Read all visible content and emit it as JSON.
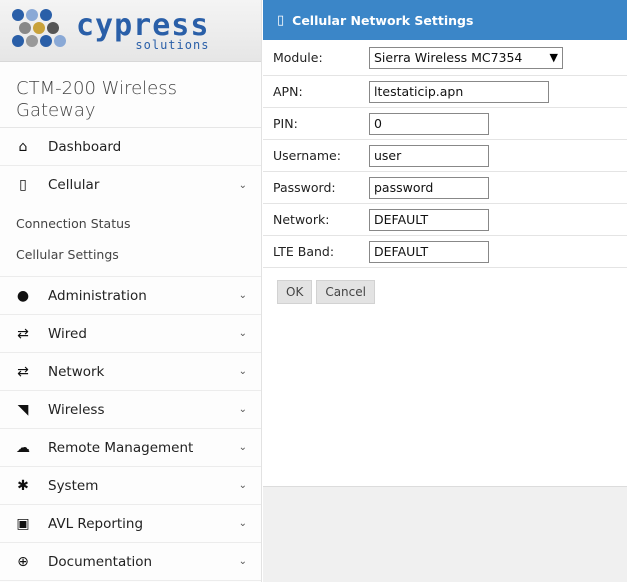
{
  "brand": {
    "word": "cypress",
    "sub": "solutions"
  },
  "gateway_title": "CTM-200 Wireless Gateway",
  "sidebar": {
    "items": [
      {
        "label": "Dashboard",
        "icon": "home-icon"
      },
      {
        "label": "Cellular",
        "icon": "mobile-icon"
      },
      {
        "label": "Administration",
        "icon": "user-icon"
      },
      {
        "label": "Wired",
        "icon": "swap-icon"
      },
      {
        "label": "Network",
        "icon": "swap-icon"
      },
      {
        "label": "Wireless",
        "icon": "rss-icon"
      },
      {
        "label": "Remote Management",
        "icon": "cloud-icon"
      },
      {
        "label": "System",
        "icon": "gear-icon"
      },
      {
        "label": "AVL Reporting",
        "icon": "bus-icon"
      },
      {
        "label": "Documentation",
        "icon": "lifebuoy-icon"
      }
    ],
    "cellular_sub": [
      "Connection Status",
      "Cellular Settings"
    ]
  },
  "panel": {
    "title": "Cellular Network Settings",
    "fields": {
      "module": {
        "label": "Module:",
        "value": "Sierra Wireless MC7354"
      },
      "apn": {
        "label": "APN:",
        "value": "ltestaticip.apn"
      },
      "pin": {
        "label": "PIN:",
        "value": "0"
      },
      "username": {
        "label": "Username:",
        "value": "user"
      },
      "password": {
        "label": "Password:",
        "value": "password"
      },
      "network": {
        "label": "Network:",
        "value": "DEFAULT"
      },
      "lte_band": {
        "label": "LTE Band:",
        "value": "DEFAULT"
      }
    },
    "ok_label": "OK",
    "cancel_label": "Cancel"
  },
  "colors": {
    "header": "#3b86c8",
    "brand": "#2a5fa8"
  }
}
